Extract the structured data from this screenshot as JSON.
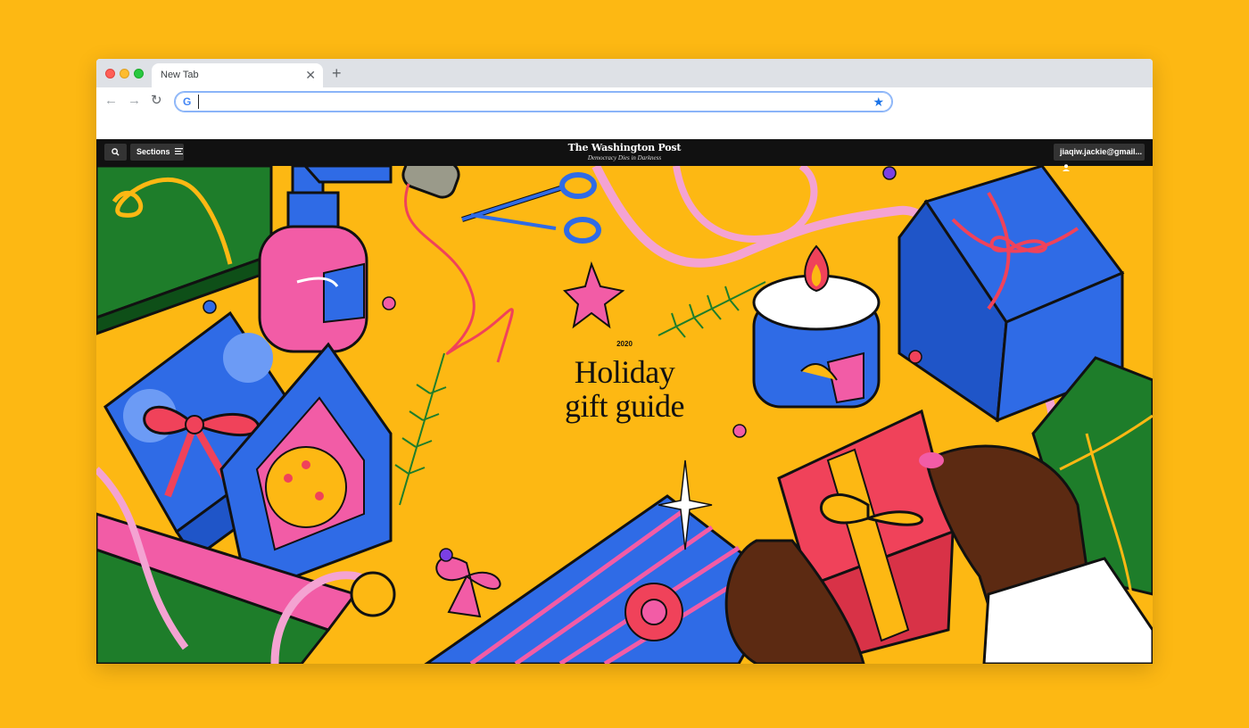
{
  "browser": {
    "tab_title": "New Tab",
    "tab_close_icon": "close-icon",
    "new_tab_symbol": "+",
    "address_value": "",
    "nav_icons": [
      "back-arrow-icon",
      "forward-arrow-icon",
      "reload-icon"
    ],
    "bookmark_icon": "star-icon"
  },
  "site": {
    "search_icon": "search-icon",
    "sections_label": "Sections",
    "masthead": "The Washington Post",
    "tagline": "Democracy Dies in Darkness",
    "account_label": "jiaqiw.jackie@gmail...",
    "account_icon": "person-icon"
  },
  "hero": {
    "year": "2020",
    "title_line1": "Holiday",
    "title_line2": "gift guide"
  },
  "colors": {
    "background": "#FDB813",
    "header": "#111111",
    "blue": "#2F6BE6",
    "pink": "#F25CA6",
    "red": "#F0425A",
    "green": "#1E7D2A"
  }
}
